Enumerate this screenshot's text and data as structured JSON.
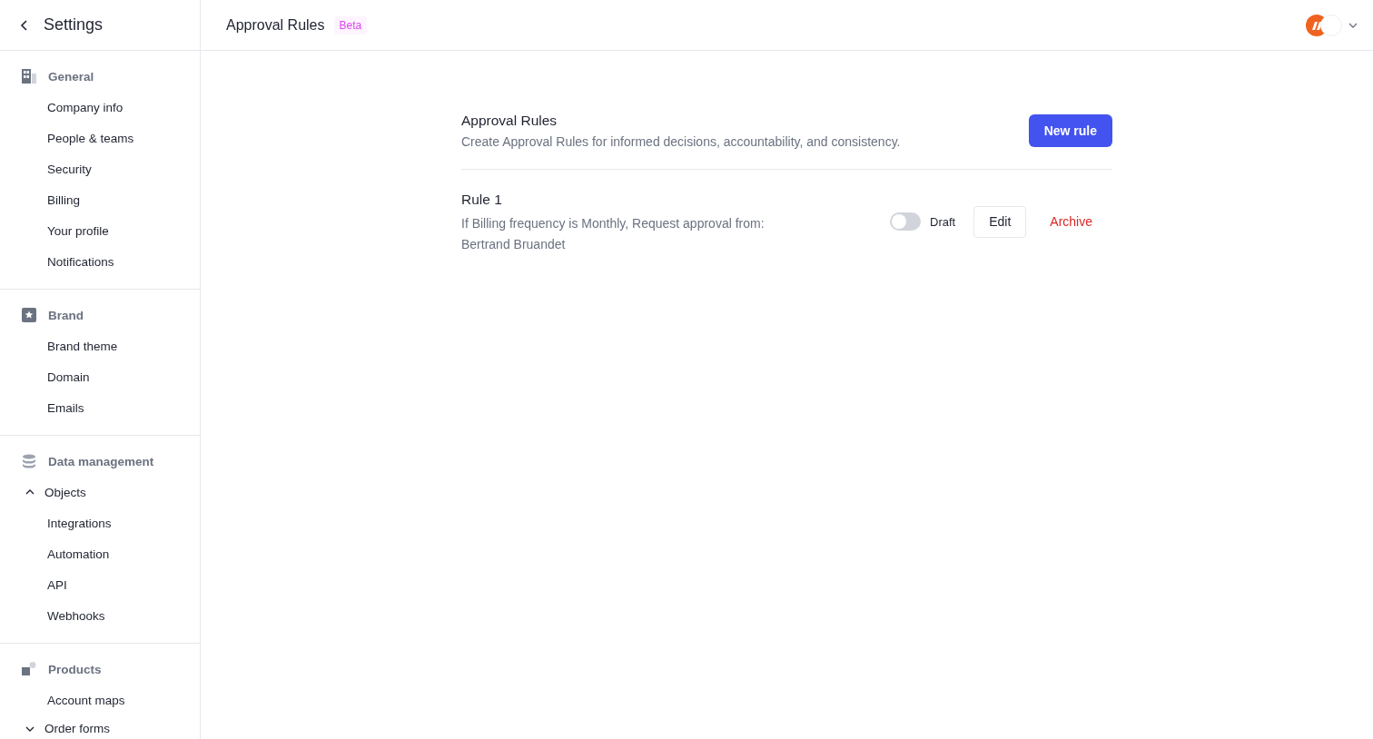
{
  "sidebar": {
    "title": "Settings",
    "sections": [
      {
        "kind": "general",
        "label": "General",
        "items": [
          {
            "label": "Company info"
          },
          {
            "label": "People & teams"
          },
          {
            "label": "Security"
          },
          {
            "label": "Billing"
          },
          {
            "label": "Your profile"
          },
          {
            "label": "Notifications"
          }
        ]
      },
      {
        "kind": "brand",
        "label": "Brand",
        "items": [
          {
            "label": "Brand theme"
          },
          {
            "label": "Domain"
          },
          {
            "label": "Emails"
          }
        ]
      },
      {
        "kind": "data",
        "label": "Data management",
        "items": [
          {
            "label": "Objects",
            "expanded": true
          },
          {
            "label": "Integrations"
          },
          {
            "label": "Automation"
          },
          {
            "label": "API"
          },
          {
            "label": "Webhooks"
          }
        ]
      },
      {
        "kind": "products",
        "label": "Products",
        "items": [
          {
            "label": "Account maps"
          },
          {
            "label": "Order forms",
            "expanded": false
          }
        ]
      }
    ]
  },
  "header": {
    "title": "Approval Rules",
    "badge": "Beta"
  },
  "content": {
    "title": "Approval Rules",
    "description": "Create Approval Rules for informed decisions, accountability, and consistency.",
    "new_button": "New rule",
    "rules": [
      {
        "name": "Rule 1",
        "description": "If Billing frequency is Monthly, Request approval from: Bertrand Bruandet",
        "on": false,
        "status": "Draft",
        "edit": "Edit",
        "archive": "Archive"
      }
    ]
  }
}
